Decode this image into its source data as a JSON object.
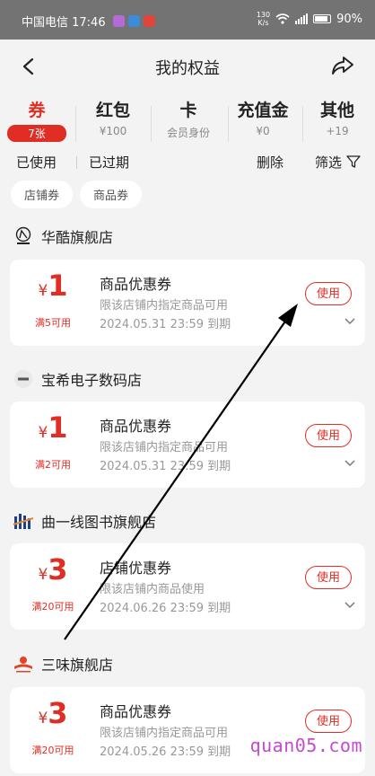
{
  "status_bar": {
    "carrier_time": "中国电信 17:46",
    "speed_value": "130",
    "speed_unit": "K/s",
    "battery": "90%"
  },
  "header": {
    "title": "我的权益"
  },
  "tabs": [
    {
      "label": "券",
      "sub": "7张",
      "active": true
    },
    {
      "label": "红包",
      "sub": "¥100"
    },
    {
      "label": "卡",
      "sub": "会员身份"
    },
    {
      "label": "充值金",
      "sub": "¥0"
    },
    {
      "label": "其他",
      "sub": "+19"
    }
  ],
  "filters": {
    "used": "已使用",
    "expired": "已过期",
    "delete": "删除",
    "filter": "筛选"
  },
  "chips": [
    "店铺券",
    "商品券"
  ],
  "shops": [
    {
      "name": "华酷旗舰店",
      "coupon": {
        "currency": "¥",
        "amount": "1",
        "condition": "满5可用",
        "title": "商品优惠券",
        "desc": "限该店铺内指定商品可用",
        "expiry": "2024.05.31 23:59 到期",
        "button": "使用"
      }
    },
    {
      "name": "宝希电子数码店",
      "coupon": {
        "currency": "¥",
        "amount": "1",
        "condition": "满2可用",
        "title": "商品优惠券",
        "desc": "限该店铺内指定商品可用",
        "expiry": "2024.05.31 23:59 到期",
        "button": "使用"
      }
    },
    {
      "name": "曲一线图书旗舰店",
      "coupon": {
        "currency": "¥",
        "amount": "3",
        "condition": "满20可用",
        "title": "店铺优惠券",
        "desc": "限该店铺内商品使用",
        "expiry": "2024.06.26 23:59 到期",
        "button": "使用"
      }
    },
    {
      "name": "三味旗舰店",
      "coupon": {
        "currency": "¥",
        "amount": "3",
        "condition": "满20可用",
        "title": "商品优惠券",
        "desc": "限该店铺内指定商品可用",
        "expiry": "2024.05.26 23:59 到期",
        "button": "使用"
      }
    }
  ],
  "watermark": "quan05.com",
  "colors": {
    "accent": "#e02e24",
    "background": "#f3f3f3",
    "status_bar": "#737373",
    "annotation_arrow": "#000000"
  }
}
